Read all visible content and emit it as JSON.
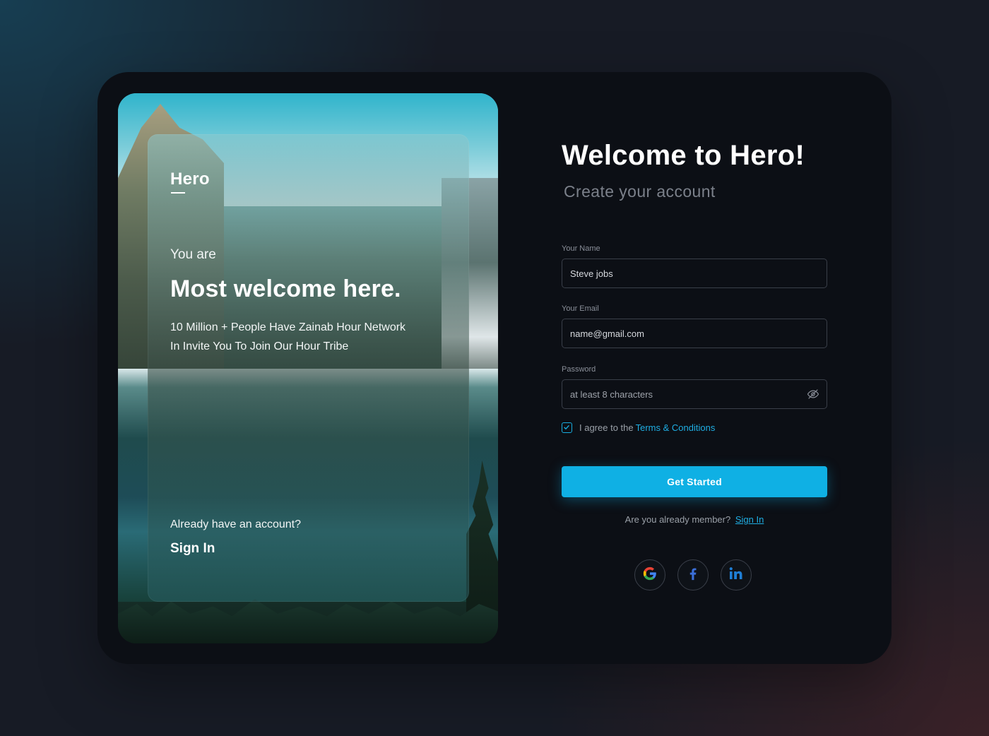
{
  "left_panel": {
    "brand": "Hero",
    "intro": "You are",
    "headline": "Most welcome here.",
    "description_line1": "10 Million + People Have Zainab Hour Network",
    "description_line2": "In Invite You To Join Our Hour Tribe",
    "already_text": "Already have an account?",
    "sign_in_label": "Sign In"
  },
  "form": {
    "title": "Welcome to Hero!",
    "subtitle": "Create your account",
    "name": {
      "label": "Your Name",
      "value": "Steve jobs"
    },
    "email": {
      "label": "Your Email",
      "value": "name@gmail.com"
    },
    "password": {
      "label": "Password",
      "placeholder": "at least 8 characters",
      "toggle_icon": "eye-off-icon"
    },
    "agree": {
      "checked": true,
      "text": "I agree to the",
      "link_text": "Terms & Conditions"
    },
    "submit_label": "Get Started",
    "member_text": "Are you already member?",
    "member_link": "Sign In",
    "socials": [
      "google-icon",
      "facebook-icon",
      "linkedin-icon"
    ]
  },
  "colors": {
    "accent": "#0fb0e4",
    "link": "#1faee3",
    "card_bg": "#0c0f15",
    "field_border": "#3a3f49"
  }
}
